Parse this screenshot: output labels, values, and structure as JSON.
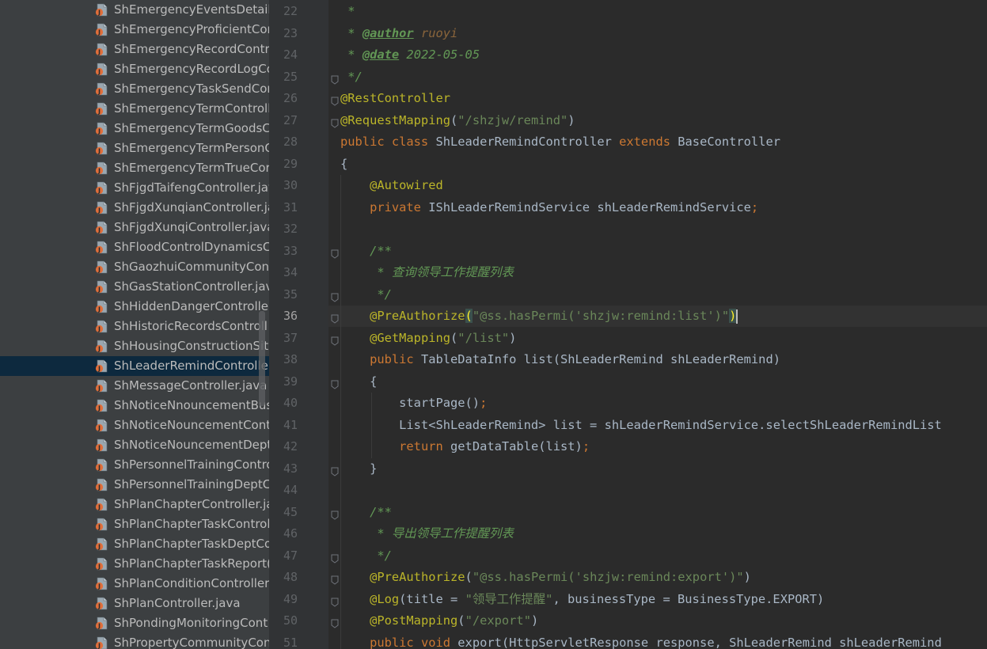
{
  "project_tree": {
    "files": [
      {
        "name": "ShEmergencyEventsDetails"
      },
      {
        "name": "ShEmergencyProficientCor"
      },
      {
        "name": "ShEmergencyRecordContro"
      },
      {
        "name": "ShEmergencyRecordLogCo"
      },
      {
        "name": "ShEmergencyTaskSendCon"
      },
      {
        "name": "ShEmergencyTermControll"
      },
      {
        "name": "ShEmergencyTermGoodsC"
      },
      {
        "name": "ShEmergencyTermPersonC"
      },
      {
        "name": "ShEmergencyTermTrueCor"
      },
      {
        "name": "ShFjgdTaifengController.jav"
      },
      {
        "name": "ShFjgdXunqianController.ja"
      },
      {
        "name": "ShFjgdXunqiController.java"
      },
      {
        "name": "ShFloodControlDynamicsC"
      },
      {
        "name": "ShGaozhuiCommunityCont"
      },
      {
        "name": "ShGasStationController.java"
      },
      {
        "name": "ShHiddenDangerController"
      },
      {
        "name": "ShHistoricRecordsControll"
      },
      {
        "name": "ShHousingConstructionSite"
      },
      {
        "name": "ShLeaderRemindController",
        "selected": true
      },
      {
        "name": "ShMessageController.java"
      },
      {
        "name": "ShNoticeNnouncementBus"
      },
      {
        "name": "ShNoticeNouncementCont"
      },
      {
        "name": "ShNoticeNouncementDept"
      },
      {
        "name": "ShPersonnelTrainingContro"
      },
      {
        "name": "ShPersonnelTrainingDeptC"
      },
      {
        "name": "ShPlanChapterController.ja"
      },
      {
        "name": "ShPlanChapterTaskControll"
      },
      {
        "name": "ShPlanChapterTaskDeptCo"
      },
      {
        "name": "ShPlanChapterTaskReport("
      },
      {
        "name": "ShPlanConditionController"
      },
      {
        "name": "ShPlanController.java"
      },
      {
        "name": "ShPondingMonitoringCont"
      },
      {
        "name": "ShPropertyCommunityCon"
      }
    ]
  },
  "editor": {
    "current_line": 36,
    "lines": [
      {
        "n": "22",
        "parts": [
          {
            "t": " *",
            "c": "cmt"
          }
        ]
      },
      {
        "n": "23",
        "parts": [
          {
            "t": " * ",
            "c": "cmt"
          },
          {
            "t": "@author",
            "c": "cmt-tag"
          },
          {
            "t": " ruoyi",
            "c": "cmt-val"
          }
        ]
      },
      {
        "n": "24",
        "parts": [
          {
            "t": " * ",
            "c": "cmt"
          },
          {
            "t": "@date",
            "c": "cmt-tag"
          },
          {
            "t": " 2022-05-05",
            "c": "cmt-date"
          }
        ]
      },
      {
        "n": "25",
        "parts": [
          {
            "t": " */",
            "c": "cmt"
          }
        ]
      },
      {
        "n": "26",
        "parts": [
          {
            "t": "@RestController",
            "c": "ann"
          }
        ]
      },
      {
        "n": "27",
        "parts": [
          {
            "t": "@RequestMapping",
            "c": "ann"
          },
          {
            "t": "(",
            "c": ""
          },
          {
            "t": "\"/shzjw/remind\"",
            "c": "str"
          },
          {
            "t": ")",
            "c": ""
          }
        ]
      },
      {
        "n": "28",
        "parts": [
          {
            "t": "public class ",
            "c": "kw"
          },
          {
            "t": "ShLeaderRemindController ",
            "c": ""
          },
          {
            "t": "extends ",
            "c": "kw"
          },
          {
            "t": "BaseController",
            "c": ""
          }
        ]
      },
      {
        "n": "29",
        "parts": [
          {
            "t": "{",
            "c": ""
          }
        ]
      },
      {
        "n": "30",
        "parts": [
          {
            "t": "    ",
            "c": ""
          },
          {
            "t": "@Autowired",
            "c": "ann"
          }
        ]
      },
      {
        "n": "31",
        "parts": [
          {
            "t": "    ",
            "c": ""
          },
          {
            "t": "private ",
            "c": "kw"
          },
          {
            "t": "IShLeaderRemindService shLeaderRemindService",
            "c": ""
          },
          {
            "t": ";",
            "c": "kw"
          }
        ]
      },
      {
        "n": "32",
        "parts": []
      },
      {
        "n": "33",
        "parts": [
          {
            "t": "    /**",
            "c": "cmt"
          }
        ]
      },
      {
        "n": "34",
        "parts": [
          {
            "t": "     * 查询领导工作提醒列表",
            "c": "cmt"
          }
        ]
      },
      {
        "n": "35",
        "parts": [
          {
            "t": "     */",
            "c": "cmt"
          }
        ]
      },
      {
        "n": "36",
        "parts": [
          {
            "t": "    ",
            "c": ""
          },
          {
            "t": "@PreAuthorize",
            "c": "ann"
          },
          {
            "t": "(",
            "c": "brace-match"
          },
          {
            "t": "\"@ss.hasPermi('shzjw:remind:list')\"",
            "c": "str"
          },
          {
            "t": ")",
            "c": "brace-match"
          },
          {
            "t": "",
            "c": "caret"
          }
        ]
      },
      {
        "n": "37",
        "parts": [
          {
            "t": "    ",
            "c": ""
          },
          {
            "t": "@GetMapping",
            "c": "ann"
          },
          {
            "t": "(",
            "c": ""
          },
          {
            "t": "\"/list\"",
            "c": "str"
          },
          {
            "t": ")",
            "c": ""
          }
        ]
      },
      {
        "n": "38",
        "parts": [
          {
            "t": "    ",
            "c": ""
          },
          {
            "t": "public ",
            "c": "kw"
          },
          {
            "t": "TableDataInfo list(ShLeaderRemind shLeaderRemind)",
            "c": ""
          }
        ]
      },
      {
        "n": "39",
        "parts": [
          {
            "t": "    {",
            "c": ""
          }
        ]
      },
      {
        "n": "40",
        "parts": [
          {
            "t": "        startPage()",
            "c": ""
          },
          {
            "t": ";",
            "c": "kw"
          }
        ]
      },
      {
        "n": "41",
        "parts": [
          {
            "t": "        List<ShLeaderRemind> list = shLeaderRemindService.selectShLeaderRemindList",
            "c": ""
          }
        ]
      },
      {
        "n": "42",
        "parts": [
          {
            "t": "        ",
            "c": ""
          },
          {
            "t": "return ",
            "c": "kw"
          },
          {
            "t": "getDataTable(list)",
            "c": ""
          },
          {
            "t": ";",
            "c": "kw"
          }
        ]
      },
      {
        "n": "43",
        "parts": [
          {
            "t": "    }",
            "c": ""
          }
        ]
      },
      {
        "n": "44",
        "parts": []
      },
      {
        "n": "45",
        "parts": [
          {
            "t": "    /**",
            "c": "cmt"
          }
        ]
      },
      {
        "n": "46",
        "parts": [
          {
            "t": "     * 导出领导工作提醒列表",
            "c": "cmt"
          }
        ]
      },
      {
        "n": "47",
        "parts": [
          {
            "t": "     */",
            "c": "cmt"
          }
        ]
      },
      {
        "n": "48",
        "parts": [
          {
            "t": "    ",
            "c": ""
          },
          {
            "t": "@PreAuthorize",
            "c": "ann"
          },
          {
            "t": "(",
            "c": ""
          },
          {
            "t": "\"@ss.hasPermi('shzjw:remind:export')\"",
            "c": "str"
          },
          {
            "t": ")",
            "c": ""
          }
        ]
      },
      {
        "n": "49",
        "parts": [
          {
            "t": "    ",
            "c": ""
          },
          {
            "t": "@Log",
            "c": "ann"
          },
          {
            "t": "(title = ",
            "c": ""
          },
          {
            "t": "\"领导工作提醒\"",
            "c": "str"
          },
          {
            "t": ", businessType = BusinessType.EXPORT)",
            "c": ""
          }
        ]
      },
      {
        "n": "50",
        "parts": [
          {
            "t": "    ",
            "c": ""
          },
          {
            "t": "@PostMapping",
            "c": "ann"
          },
          {
            "t": "(",
            "c": ""
          },
          {
            "t": "\"/export\"",
            "c": "str"
          },
          {
            "t": ")",
            "c": ""
          }
        ]
      },
      {
        "n": "51",
        "parts": [
          {
            "t": "    ",
            "c": ""
          },
          {
            "t": "public void ",
            "c": "kw"
          },
          {
            "t": "export(HttpServletResponse response, ShLeaderRemind shLeaderRemind",
            "c": ""
          }
        ]
      }
    ]
  },
  "colors": {
    "sidebar_bg": "#3c3f41",
    "selected_row": "#0d293e",
    "editor_bg": "#2b2b2b",
    "gutter_bg": "#313335",
    "keyword": "#cc7832",
    "string": "#6a8759",
    "annotation": "#bbb529",
    "comment": "#629755"
  }
}
